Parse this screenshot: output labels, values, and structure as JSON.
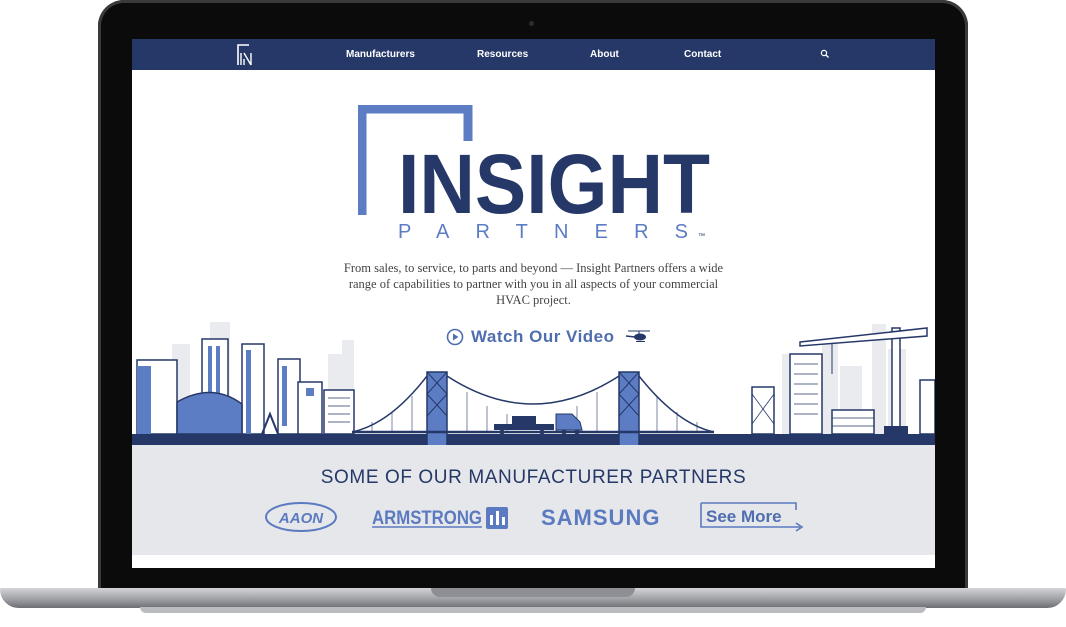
{
  "nav": {
    "items": [
      "Manufacturers",
      "Resources",
      "About",
      "Contact"
    ],
    "search_icon": "search-icon",
    "brand_color": "#253868"
  },
  "hero": {
    "logo_word": "INSIGHT",
    "logo_sub": "PARTNERS",
    "logo_tm": "™",
    "tagline": "From sales, to service, to parts and beyond — Insight Partners offers a wide range of capabilities to partner with you in all aspects of your commercial HVAC project.",
    "video_label": "Watch Our Video",
    "accent_color": "#4f6eb0"
  },
  "partners": {
    "title": "SOME OF OUR MANUFACTURER PARTNERS",
    "logos": [
      "AAON",
      "ARMSTRONG",
      "SAMSUNG"
    ],
    "see_more": "See More",
    "band_color": "#e5e7eb"
  }
}
